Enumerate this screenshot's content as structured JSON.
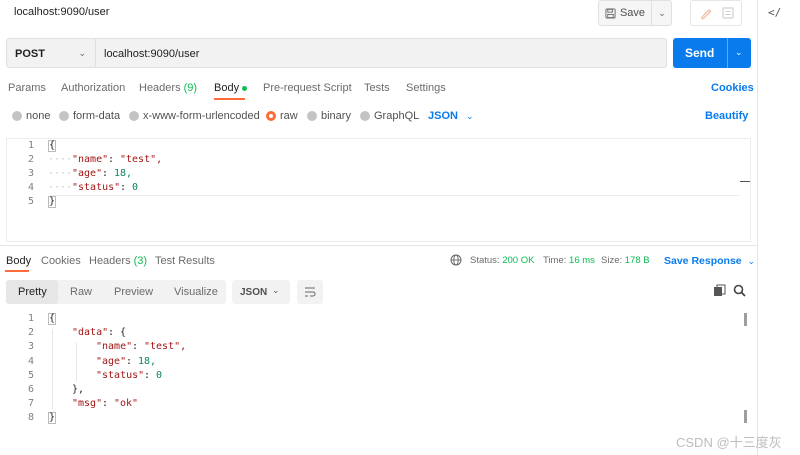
{
  "tab_title": "localhost:9090/user",
  "toolbar": {
    "save_label": "Save",
    "code_toggle": "</"
  },
  "request": {
    "method": "POST",
    "url": "localhost:9090/user",
    "send_label": "Send"
  },
  "request_tabs": {
    "params": "Params",
    "authorization": "Authorization",
    "headers": "Headers",
    "headers_count": "(9)",
    "body": "Body",
    "prerequest": "Pre-request Script",
    "tests": "Tests",
    "settings": "Settings",
    "cookies": "Cookies"
  },
  "body_types": {
    "none": "none",
    "form_data": "form-data",
    "urlencoded": "x-www-form-urlencoded",
    "raw": "raw",
    "binary": "binary",
    "graphql": "GraphQL",
    "format": "JSON",
    "beautify": "Beautify",
    "selected": "raw"
  },
  "request_body_lines": [
    {
      "n": "1",
      "text": "{"
    },
    {
      "n": "2",
      "key": "\"name\"",
      "val": "\"test\","
    },
    {
      "n": "3",
      "key": "\"age\"",
      "val": "18,"
    },
    {
      "n": "4",
      "key": "\"status\"",
      "val": "0"
    },
    {
      "n": "5",
      "text": "}"
    }
  ],
  "response_tabs": {
    "body": "Body",
    "cookies": "Cookies",
    "headers": "Headers",
    "headers_count": "(3)",
    "test_results": "Test Results"
  },
  "response_status": {
    "status_label": "Status:",
    "status_value": "200 OK",
    "time_label": "Time:",
    "time_value": "16 ms",
    "size_label": "Size:",
    "size_value": "178 B",
    "save_response": "Save Response"
  },
  "response_view": {
    "pretty": "Pretty",
    "raw": "Raw",
    "preview": "Preview",
    "visualize": "Visualize",
    "format": "JSON"
  },
  "response_body_lines": [
    {
      "n": "1",
      "text": "{"
    },
    {
      "n": "2",
      "indent": 1,
      "key": "\"data\"",
      "val": "{"
    },
    {
      "n": "3",
      "indent": 2,
      "key": "\"name\"",
      "val": "\"test\","
    },
    {
      "n": "4",
      "indent": 2,
      "key": "\"age\"",
      "val": "18,"
    },
    {
      "n": "5",
      "indent": 2,
      "key": "\"status\"",
      "val": "0"
    },
    {
      "n": "6",
      "indent": 1,
      "text": "},"
    },
    {
      "n": "7",
      "indent": 1,
      "key": "\"msg\"",
      "val": "\"ok\""
    },
    {
      "n": "8",
      "text": "}"
    }
  ],
  "watermark": "CSDN @十三度灰",
  "colors": {
    "accent": "#ff6c37",
    "send": "#097bed",
    "success": "#0cbb52"
  }
}
